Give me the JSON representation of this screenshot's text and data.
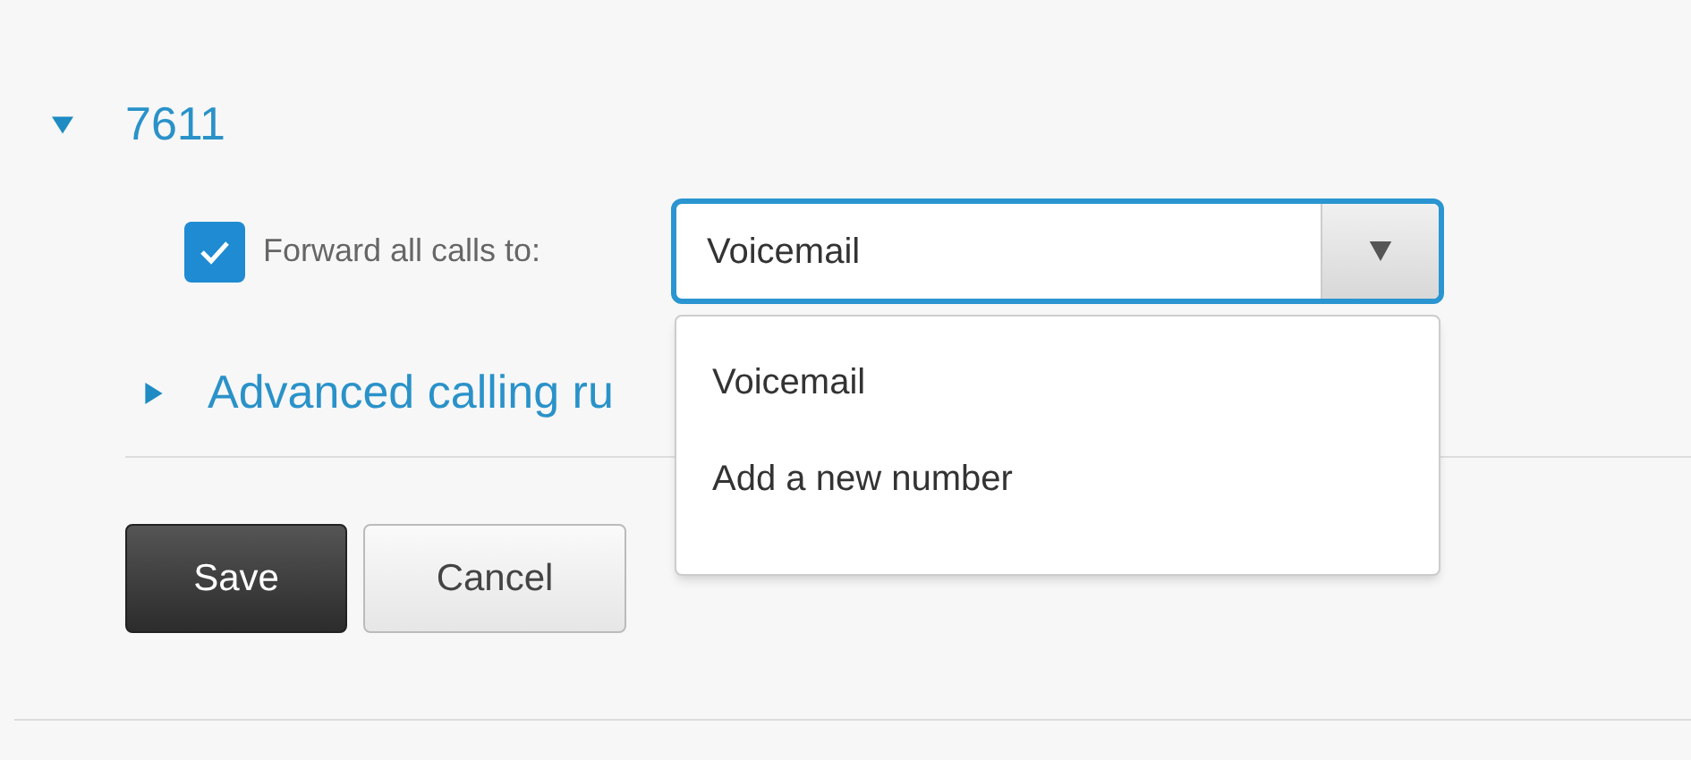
{
  "line": {
    "number": "7611",
    "expanded": true
  },
  "forward": {
    "checked": true,
    "label": "Forward all calls to:",
    "value": "Voicemail",
    "menu_open": true,
    "options": [
      "Voicemail",
      "Add a new number"
    ]
  },
  "advanced": {
    "label": "Advanced calling ru",
    "expanded": false
  },
  "buttons": [
    {
      "label": "Save",
      "kind": "primary"
    },
    {
      "label": "Cancel",
      "kind": "secondary"
    }
  ]
}
